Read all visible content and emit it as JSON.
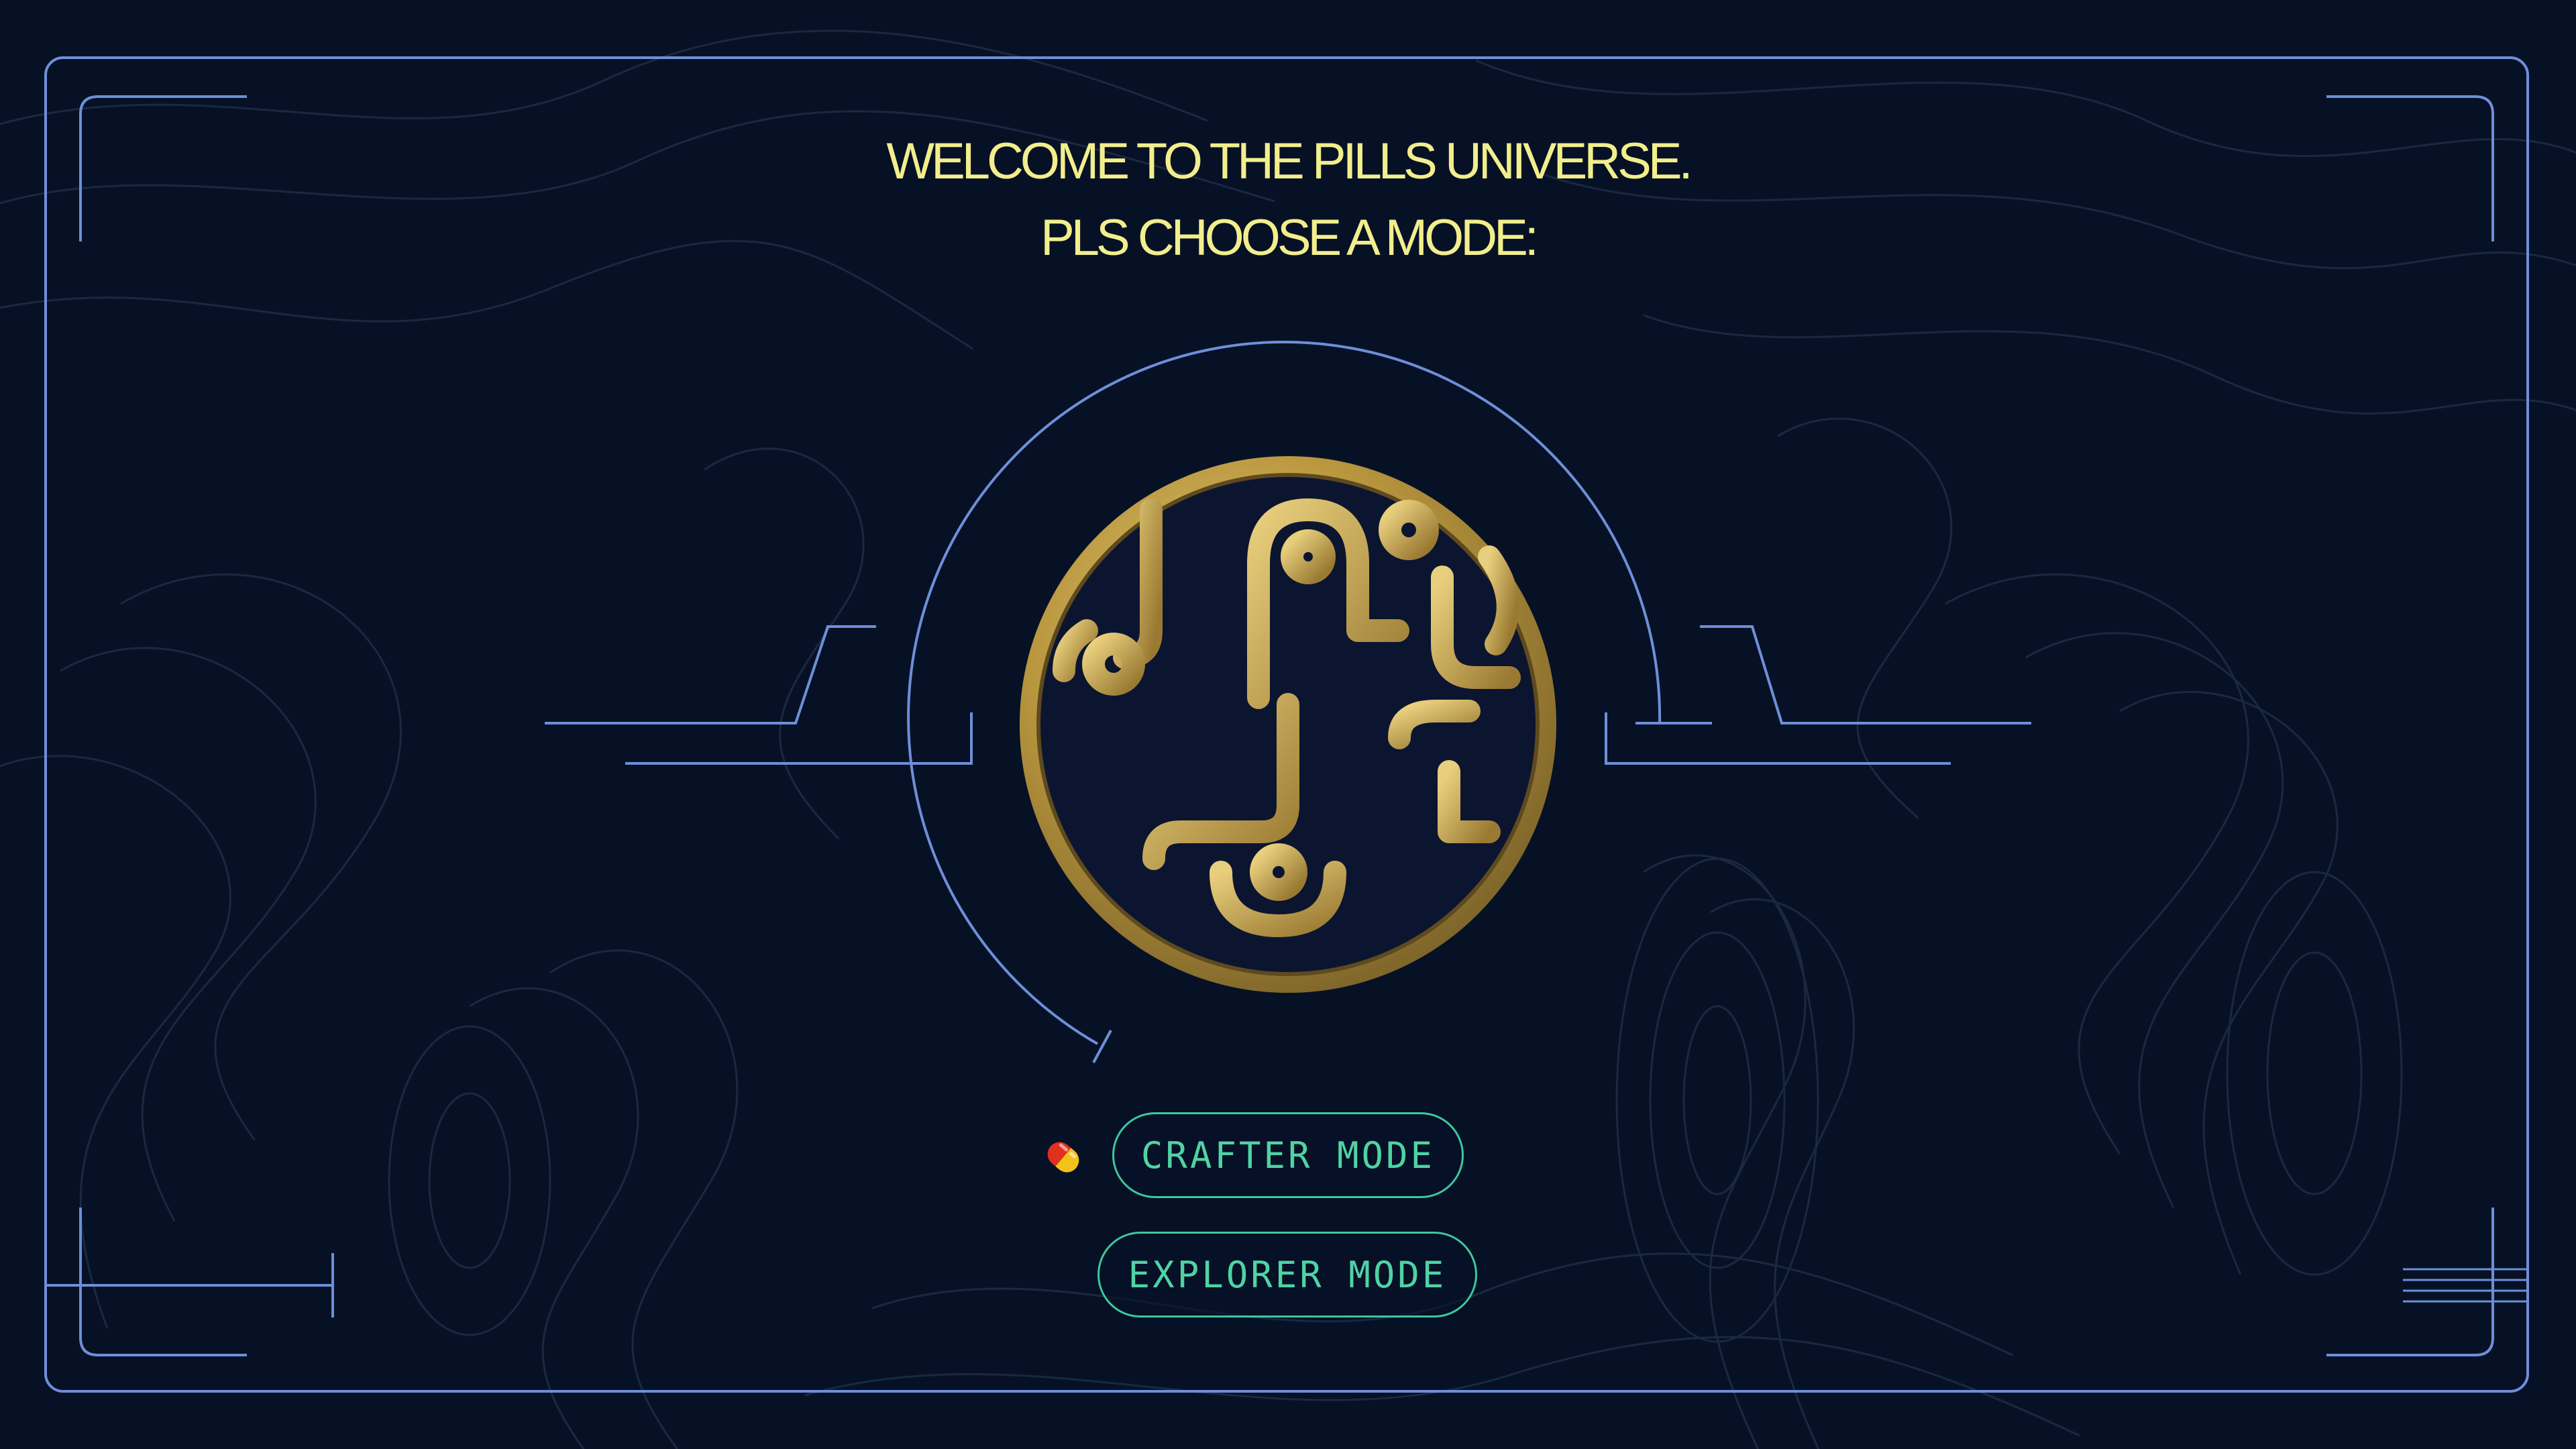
{
  "heading": {
    "line1": "WELCOME TO THE PILLS UNIVERSE.",
    "line2": "PLS CHOOSE A MODE:"
  },
  "buttons": {
    "crafter": "CRAFTER MODE",
    "explorer": "EXPLORER MODE"
  },
  "icons": {
    "logo": "gold-circuit-emblem-icon",
    "pill": "pill-capsule-icon"
  },
  "colors": {
    "background": "#071126",
    "frame_line": "#6f8fd6",
    "heading_text": "#f2ee8c",
    "button_text": "#4fd3a4",
    "button_border": "#3fc79a",
    "gold": "#c9a94c",
    "pill_red": "#e0301e",
    "pill_yellow": "#f2c21a",
    "contour": "#1c2942"
  }
}
